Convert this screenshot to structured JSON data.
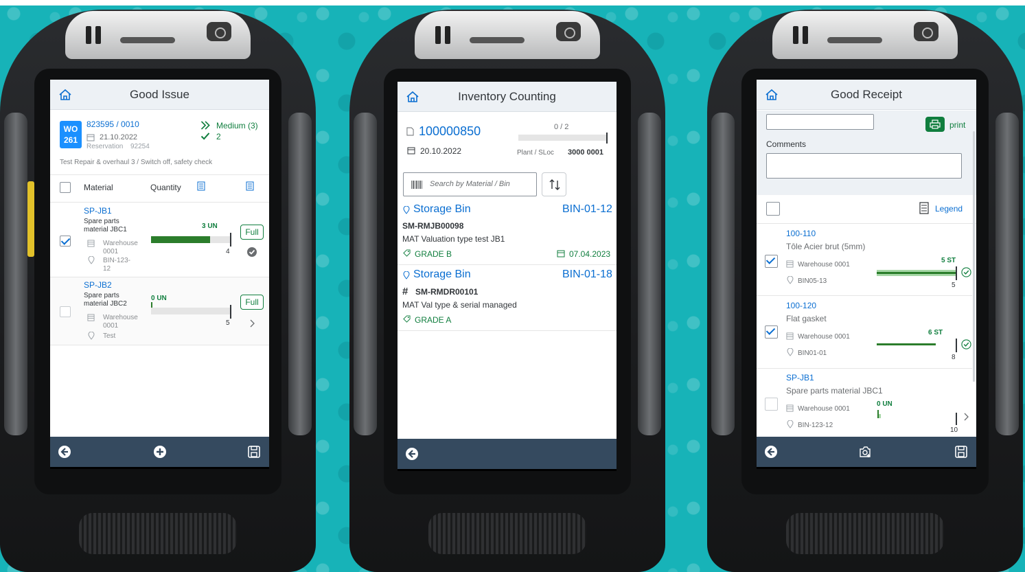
{
  "screen1": {
    "title": "Good Issue",
    "wo_badge_top": "WO",
    "wo_badge_bottom": "261",
    "order_number": "823595 / 0010",
    "date": "21.10.2022",
    "reservation_label": "Reservation",
    "reservation_number": "92254",
    "priority": "Medium (3)",
    "done_count": "2",
    "description": "Test Repair & overhaul 3 / Switch off, safety check",
    "col_material": "Material",
    "col_quantity": "Quantity",
    "items": [
      {
        "id": "SP-JB1",
        "desc_line1": "Spare parts",
        "desc_line2": "material JBC1",
        "warehouse_line1": "Warehouse",
        "warehouse_line2": "0001",
        "bin_line1": "BIN-123-",
        "bin_line2": "12",
        "quantity_label": "3 UN",
        "quantity": 3,
        "target": "4",
        "target_value": 4,
        "button": "Full",
        "checked": true
      },
      {
        "id": "SP-JB2",
        "desc_line1": "Spare parts",
        "desc_line2": "material JBC2",
        "warehouse_line1": "Warehouse",
        "warehouse_line2": "0001",
        "bin_line1": "Test",
        "quantity_label": "0 UN",
        "quantity": 0,
        "target": "5",
        "target_value": 5,
        "button": "Full",
        "checked": false
      }
    ]
  },
  "screen2": {
    "title": "Inventory Counting",
    "doc_number": "100000850",
    "progress_label": "0 / 2",
    "progress_done": 0,
    "progress_total": 2,
    "date": "20.10.2022",
    "plant_label": "Plant / SLoc",
    "plant_value": "3000 0001",
    "search_placeholder": "Search by Material / Bin",
    "items": [
      {
        "bin_label": "Storage Bin",
        "bin_value": "BIN-01-12",
        "material": "SM-RMJB00098",
        "material_desc": "MAT Valuation type test JB1",
        "grade": "GRADE B",
        "date": "07.04.2023"
      },
      {
        "bin_label": "Storage Bin",
        "bin_value": "BIN-01-18",
        "material": "SM-RMDR00101",
        "material_desc": "MAT Val type & serial managed",
        "grade": "GRADE A"
      }
    ]
  },
  "screen3": {
    "title": "Good Receipt",
    "print_label": "print",
    "comments_label": "Comments",
    "legend_label": "Legend",
    "items": [
      {
        "id": "100-110",
        "desc": "Tôle Acier brut (5mm)",
        "warehouse": "Warehouse 0001",
        "bin": "BIN05-13",
        "quantity_label": "5 ST",
        "quantity": 5,
        "target": "5",
        "target_value": 5,
        "checked": true
      },
      {
        "id": "100-120",
        "desc": "Flat gasket",
        "warehouse": "Warehouse 0001",
        "bin": "BIN01-01",
        "quantity_label": "6 ST",
        "quantity": 6,
        "target": "8",
        "target_value": 8,
        "checked": true
      },
      {
        "id": "SP-JB1",
        "desc": "Spare parts material JBC1",
        "warehouse": "Warehouse 0001",
        "bin": "BIN-123-12",
        "quantity_label": "0 UN",
        "quantity": 0,
        "target": "10",
        "target_value": 10,
        "checked": false
      }
    ]
  },
  "colors": {
    "background": "#17b3b8",
    "accent_blue": "#0a6ed1",
    "positive_green": "#107e3e",
    "footer": "#354a5f",
    "shellbar": "#edf1f5"
  },
  "icons": [
    "home-icon",
    "back-icon",
    "add-icon",
    "save-icon",
    "print-icon",
    "legend-icon",
    "calendar-icon",
    "location-icon",
    "warehouse-icon",
    "barcode-icon",
    "sort-icon",
    "camera-icon",
    "grade-icon",
    "document-icon",
    "chevron-right-icon",
    "check-circle-icon"
  ]
}
